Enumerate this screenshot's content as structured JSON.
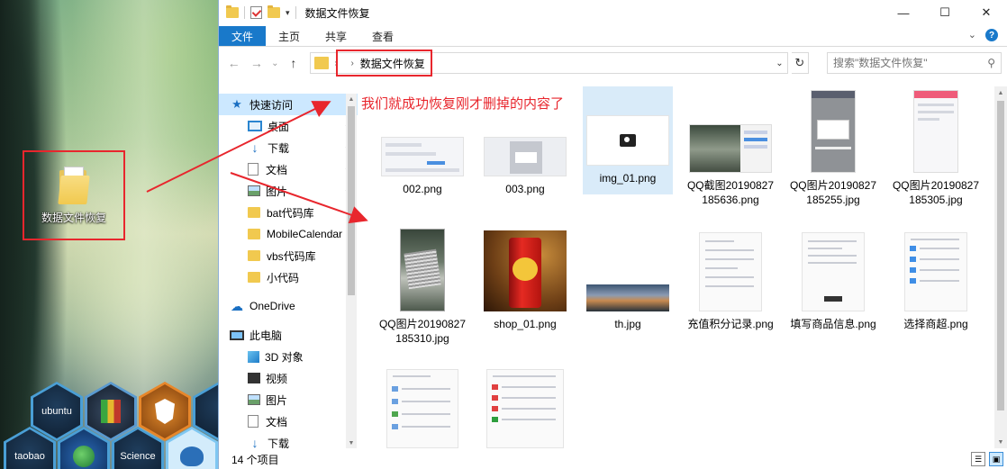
{
  "desktop": {
    "folder_label": "数据文件恢复",
    "dock": [
      {
        "label": "ubuntu"
      },
      {
        "label": "taobao"
      },
      {
        "label": "Science"
      }
    ]
  },
  "window": {
    "title": "数据文件恢复",
    "controls": {
      "minimize": "—",
      "maximize": "☐",
      "close": "✕"
    }
  },
  "ribbon": {
    "tabs": [
      {
        "label": "文件",
        "active": true
      },
      {
        "label": "主页"
      },
      {
        "label": "共享"
      },
      {
        "label": "查看"
      }
    ],
    "expand_glyph": "⌄",
    "help_glyph": "?"
  },
  "navbar": {
    "back_glyph": "←",
    "forward_glyph": "→",
    "history_glyph": "⌄",
    "up_glyph": "↑",
    "address_path": "数据文件恢复",
    "refresh_glyph": "↻",
    "search_placeholder": "搜索\"数据文件恢复\"",
    "search_glyph": "⚲"
  },
  "sidebar": {
    "items": [
      {
        "label": "快速访问",
        "icon": "star-icon",
        "selected": true
      },
      {
        "label": "桌面",
        "icon": "desktop-icon",
        "pinned": true,
        "sub": true
      },
      {
        "label": "下载",
        "icon": "download-icon",
        "pinned": true,
        "sub": true
      },
      {
        "label": "文档",
        "icon": "document-icon",
        "pinned": true,
        "sub": true
      },
      {
        "label": "图片",
        "icon": "pictures-icon",
        "pinned": true,
        "sub": true
      },
      {
        "label": "bat代码库",
        "icon": "folder-icon",
        "sub": true
      },
      {
        "label": "MobileCalendar",
        "icon": "folder-icon",
        "sub": true
      },
      {
        "label": "vbs代码库",
        "icon": "folder-icon",
        "sub": true
      },
      {
        "label": "小代码",
        "icon": "folder-icon",
        "sub": true
      },
      {
        "label": "OneDrive",
        "icon": "cloud-icon"
      },
      {
        "label": "此电脑",
        "icon": "pc-icon"
      },
      {
        "label": "3D 对象",
        "icon": "cube-icon",
        "sub": true
      },
      {
        "label": "视频",
        "icon": "video-icon",
        "sub": true
      },
      {
        "label": "图片",
        "icon": "pictures-icon",
        "sub": true
      },
      {
        "label": "文档",
        "icon": "document-icon",
        "sub": true
      },
      {
        "label": "下载",
        "icon": "download-icon",
        "sub": true
      }
    ],
    "pin_glyph": "📌"
  },
  "content": {
    "annotation": "我们就成功恢复刚才删掉的内容了",
    "files": [
      {
        "name": "002.png"
      },
      {
        "name": "003.png"
      },
      {
        "name": "img_01.png",
        "selected": true
      },
      {
        "name": "QQ截图20190827185636.png"
      },
      {
        "name": "QQ图片20190827185255.jpg"
      },
      {
        "name": "QQ图片20190827185305.jpg"
      },
      {
        "name": "QQ图片20190827185310.jpg"
      },
      {
        "name": "shop_01.png"
      },
      {
        "name": "th.jpg"
      },
      {
        "name": "充值积分记录.png"
      },
      {
        "name": "填写商品信息.png"
      },
      {
        "name": "选择商超.png"
      },
      {
        "name": ""
      },
      {
        "name": ""
      }
    ]
  },
  "status": {
    "count": "14 个项目"
  },
  "colors": {
    "accent": "#1979ca",
    "highlight_red": "#e8262d",
    "selection": "#cce8ff"
  }
}
